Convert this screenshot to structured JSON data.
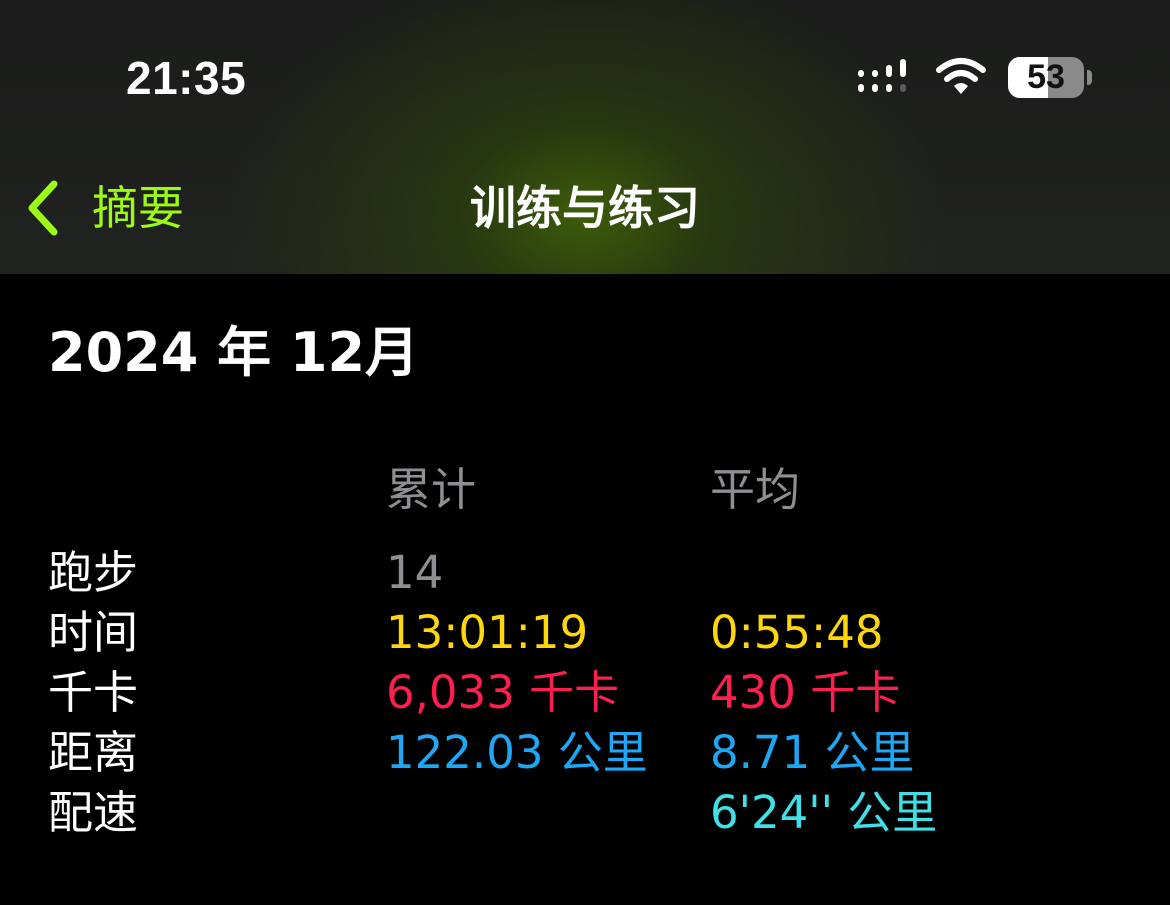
{
  "status_bar": {
    "time": "21:35",
    "battery_percent": 53,
    "battery_label": "53"
  },
  "nav": {
    "back_label": "摘要",
    "title": "训练与练习"
  },
  "month_title": "2024 年 12月",
  "table": {
    "columns": [
      "累计",
      "平均"
    ],
    "rows": [
      {
        "label": "跑步",
        "total": "14",
        "average": ""
      },
      {
        "label": "时间",
        "total": "13:01:19",
        "average": "0:55:48"
      },
      {
        "label": "千卡",
        "total": "6,033 千卡",
        "average": "430 千卡"
      },
      {
        "label": "距离",
        "total": "122.03 公里",
        "average": "8.71 公里"
      },
      {
        "label": "配速",
        "total": "",
        "average": "6'24'' 公里"
      }
    ]
  },
  "colors": {
    "accent_green": "#9dfa14",
    "time_yellow": "#ffd60a",
    "calories_red": "#ff1f4f",
    "distance_blue": "#1ea7f5",
    "pace_cyan": "#40e0e8"
  }
}
